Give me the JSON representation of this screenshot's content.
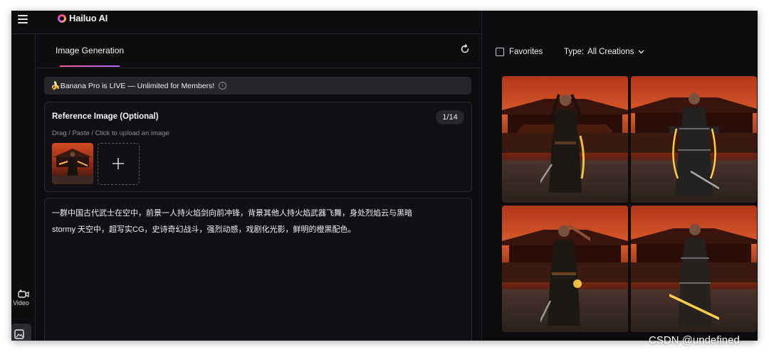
{
  "app": {
    "name": "Hailuo AI"
  },
  "rail": {
    "video_label": "Video"
  },
  "panel": {
    "tab_label": "Image Generation",
    "banner": {
      "emoji": "🍌",
      "text": "Banana Pro is LIVE — Unlimited for Members!"
    },
    "reference": {
      "title": "Reference Image (Optional)",
      "count": "1/14",
      "hint": "Drag / Paste / Click to upload an image"
    },
    "prompt": {
      "line1": "一群中国古代武士在空中，前景一人持火焰剑向前冲锋，背景其他人持火焰武器飞舞，身处烈焰云与黑暗",
      "line2": "stormy 天空中，超写实CG，史诗奇幻战斗，强烈动感，戏剧化光影，鲜明的橙黑配色。"
    }
  },
  "gallery": {
    "favorites_label": "Favorites",
    "type_label": "Type:",
    "type_value": "All Creations"
  },
  "watermark": "CSDN @undefined",
  "colors": {
    "accent_gradient_start": "#ff5c8a",
    "accent_gradient_end": "#a66bff",
    "background": "#0d0d10"
  },
  "icons": [
    "hamburger-icon",
    "refresh-icon",
    "info-icon",
    "plus-icon",
    "chevron-down-icon",
    "video-icon",
    "image-icon"
  ]
}
